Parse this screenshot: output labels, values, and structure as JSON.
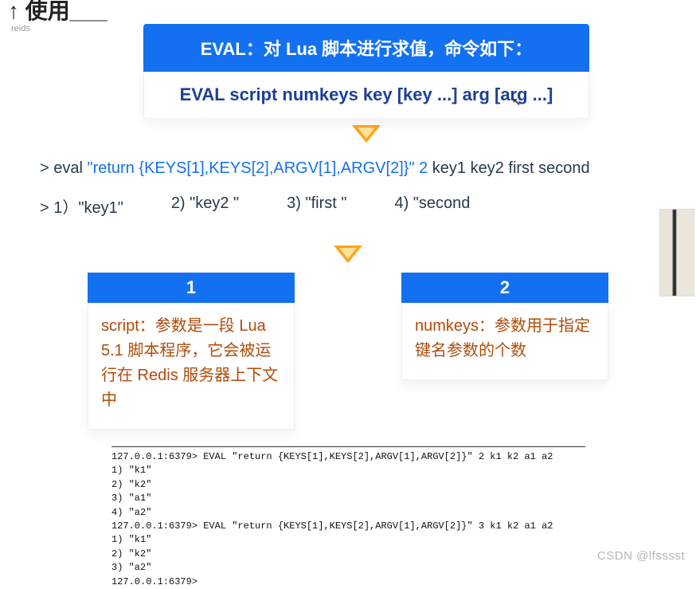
{
  "fragments": {
    "top_text": "↑ 使用___",
    "reids": "reids"
  },
  "hero": {
    "title": "EVAL：对 Lua 脚本进行求值，命令如下：",
    "syntax": "EVAL script numkeys key [key ...] arg [arg ...]"
  },
  "example": {
    "prefix": "> eval ",
    "quoted": "\"return {KEYS[1],KEYS[2],ARGV[1],ARGV[2]}\"",
    "numkeys": "2",
    "rest": " key1 key2 first second",
    "outputs": {
      "o1": "> 1）\"key1\"",
      "o2": "2) \"key2 \"",
      "o3": "3) \"first \"",
      "o4": "4) \"second"
    }
  },
  "boxes": {
    "b1": {
      "num": "1",
      "text": "script：参数是一段 Lua 5.1 脚本程序，它会被运行在 Redis 服务器上下文中"
    },
    "b2": {
      "num": "2",
      "text": "numkeys：参数用于指定键名参数的个数"
    }
  },
  "terminal": {
    "l01": "127.0.0.1:6379> EVAL \"return {KEYS[1],KEYS[2],ARGV[1],ARGV[2]}\" 2 k1 k2 a1 a2",
    "l02": "1) \"k1\"",
    "l03": "2) \"k2\"",
    "l04": "3) \"a1\"",
    "l05": "4) \"a2\"",
    "l06": "127.0.0.1:6379> EVAL \"return {KEYS[1],KEYS[2],ARGV[1],ARGV[2]}\" 3 k1 k2 a1 a2",
    "l07": "1) \"k1\"",
    "l08": "2) \"k2\"",
    "l09": "3) \"a2\"",
    "l10": "127.0.0.1:6379> "
  },
  "watermark": "CSDN @lfsssst"
}
